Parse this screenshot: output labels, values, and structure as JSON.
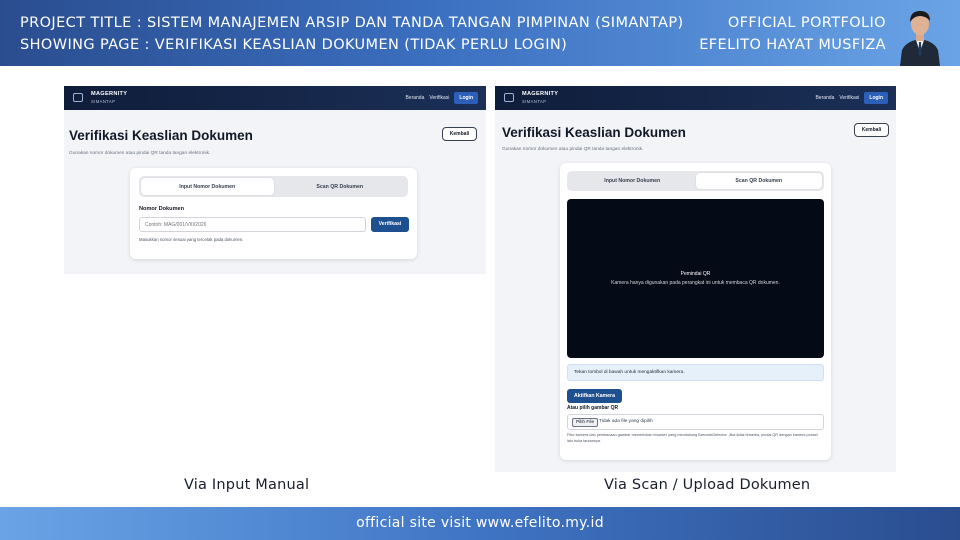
{
  "header": {
    "line1": "PROJECT TITLE  : SISTEM MANAJEMEN ARSIP DAN TANDA TANGAN PIMPINAN (SIMANTAP)",
    "line2": "SHOWING PAGE : VERIFIKASI KEASLIAN DOKUMEN (TIDAK PERLU LOGIN)",
    "portfolio_label": "OFFICIAL PORTFOLIO",
    "author": "EFELITO HAYAT MUSFIZA"
  },
  "app": {
    "brand": "MAGERNITY",
    "brand_sub": "SIMANTAP",
    "nav_links": [
      "Beranda",
      "Verifikasi"
    ],
    "login_label": "Login",
    "page_title": "Verifikasi Keaslian Dokumen",
    "page_subtitle": "Gunakan nomor dokumen atau pindai QR tanda tangan elektronik.",
    "back_label": "Kembali",
    "tabs": [
      "Input Nomor Dokumen",
      "Scan QR Dokumen"
    ]
  },
  "manual": {
    "field_label": "Nomor Dokumen",
    "placeholder": "Contoh: MAG/001/VIII/2026",
    "button_label": "Verifikasi",
    "hint": "Masukkan nomor sesuai yang tercetak pada dokumen."
  },
  "scan": {
    "camera_title": "Pemindai QR",
    "camera_desc": "Kamera hanya digunakan pada perangkat ini untuk membaca QR dokumen.",
    "info": "Tekan tombol di bawah untuk mengaktifkan kamera.",
    "activate_label": "Aktifkan Kamera",
    "upload_label": "Atau pilih gambar QR",
    "file_button": "Pilih File",
    "file_status": "Tidak ada file yang dipilih",
    "note": "Fitur kamera dan pembacaan gambar memerlukan browser yang mendukung BarcodeDetector. Jika tidak tersedia, pindai QR dengan kamera ponsel lalu buka tautannya."
  },
  "captions": {
    "left": "Via Input Manual",
    "right": "Via Scan / Upload Dokumen"
  },
  "footer": {
    "text": "official site visit www.efelito.my.id"
  },
  "colors": {
    "banner_dark": "#2a4d8f",
    "banner_light": "#6aa4e6",
    "nav_bg": "#0f1d3a",
    "primary_button": "#1e4f8f",
    "camera_bg": "#050b16"
  },
  "icons": {
    "logo": "archive-logo-icon",
    "avatar": "person-photo"
  }
}
